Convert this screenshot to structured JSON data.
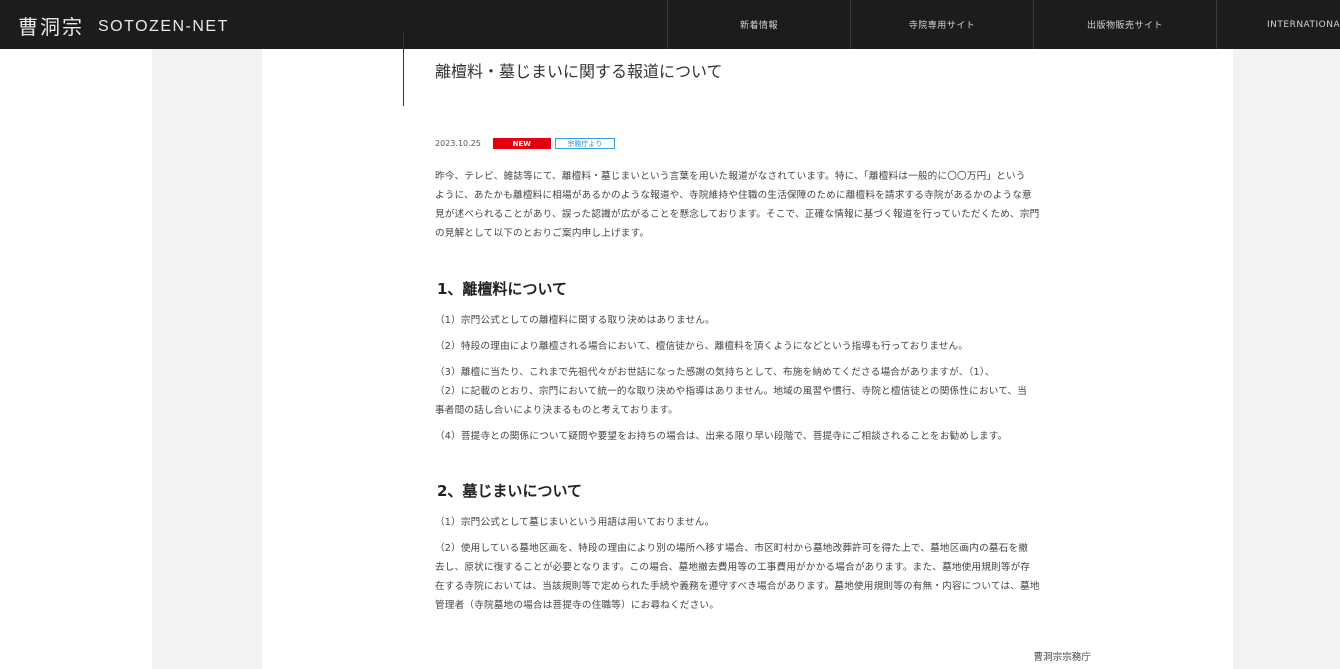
{
  "header": {
    "logo_kanji": "曹洞宗",
    "logo_latin": "SOTOZEN-NET",
    "nav": [
      "新着情報",
      "寺院専用サイト",
      "出版物販売サイト",
      "INTERNATIONAL"
    ]
  },
  "article": {
    "title": "離檀料・墓じまいに関する報道について",
    "date": "2023.10.25",
    "badge_new": "NEW",
    "badge_category": "宗務庁より",
    "intro_lines": [
      "昨今、テレビ、雑誌等にて、離檀料・墓じまいという言葉を用いた報道がなされています。特に、「離檀料は一般的に〇〇万円」という",
      "ように、あたかも離檀料に相場があるかのような報道や、寺院維持や住職の生活保障のために離檀料を請求する寺院があるかのような意",
      "見が述べられることがあり、誤った認識が広がることを懸念しております。そこで、正確な情報に基づく報道を行っていただくため、宗門",
      "の見解として以下のとおりご案内申し上げます。"
    ],
    "section1": {
      "heading": "1、離檀料について",
      "items": [
        [
          "（1）宗門公式としての離檀料に関する取り決めはありません。"
        ],
        [
          "（2）特段の理由により離檀される場合において、檀信徒から、離檀料を頂くようになどという指導も行っておりません。"
        ],
        [
          "（3）離檀に当たり、これまで先祖代々がお世話になった感謝の気持ちとして、布施を納めてくださる場合がありますが、（1）、",
          "（2）に記載のとおり、宗門において統一的な取り決めや指導はありません。地域の風習や慣行、寺院と檀信徒との関係性において、当",
          "事者間の話し合いにより決まるものと考えております。"
        ],
        [
          "（4）菩提寺との関係について疑問や要望をお持ちの場合は、出来る限り早い段階で、菩提寺にご相談されることをお勧めします。"
        ]
      ]
    },
    "section2": {
      "heading": "2、墓じまいについて",
      "items": [
        [
          "（1）宗門公式として墓じまいという用語は用いておりません。"
        ],
        [
          "（2）使用している墓地区画を、特段の理由により別の場所へ移す場合、市区町村から墓地改葬許可を得た上で、墓地区画内の墓石を撤",
          "去し、原状に復することが必要となります。この場合、墓地撤去費用等の工事費用がかかる場合があります。また、墓地使用規則等が存",
          "在する寺院においては、当該規則等で定められた手続や義務を遵守すべき場合があります。墓地使用規則等の有無・内容については、墓地",
          "管理者（寺院墓地の場合は菩提寺の住職等）にお尋ねください。"
        ]
      ]
    },
    "signature": "曹洞宗宗務庁"
  }
}
